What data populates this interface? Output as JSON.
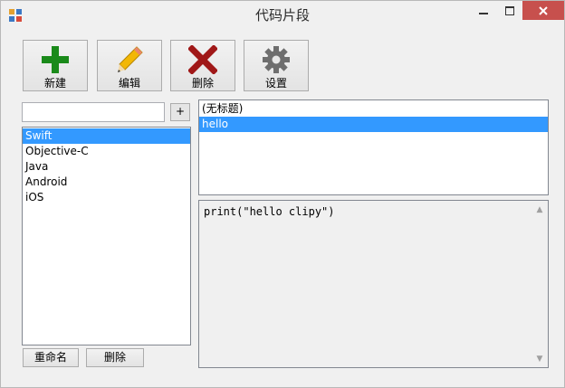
{
  "window": {
    "title": "代码片段"
  },
  "toolbar": {
    "new_label": "新建",
    "edit_label": "编辑",
    "delete_label": "删除",
    "settings_label": "设置"
  },
  "search": {
    "value": "",
    "add_label": "+"
  },
  "categories": {
    "items": [
      "Swift",
      "Objective-C",
      "Java",
      "Android",
      "iOS"
    ],
    "selected": "Swift",
    "rename_label": "重命名",
    "delete_label": "删除"
  },
  "snippets": {
    "items": [
      "(无标题)",
      "hello"
    ],
    "selected": "hello"
  },
  "code": {
    "text": "print(\"hello clipy\")"
  },
  "colors": {
    "selection": "#3399ff",
    "close": "#c7504d",
    "add": "#1a8a1a",
    "delete": "#a01818",
    "edit": "#f2b705"
  },
  "icons": [
    "app-icon",
    "minimize-icon",
    "maximize-icon",
    "close-icon",
    "plus-icon",
    "pencil-icon",
    "cross-icon",
    "gear-icon"
  ]
}
